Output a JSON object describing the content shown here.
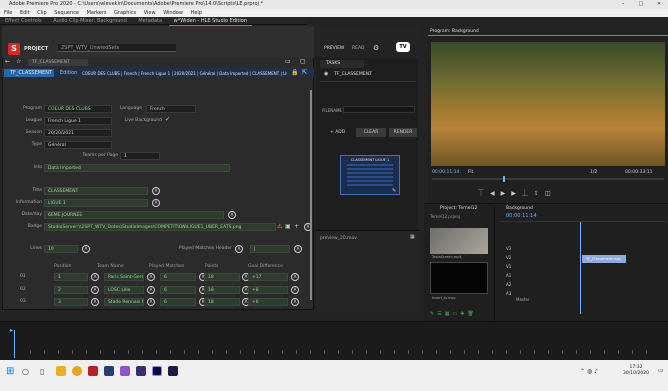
{
  "window": {
    "title": "Adobe Premiere Pro 2020 - C:\\Users\\wlevekin\\Documents\\Adobe\\Premiere Pro\\14.0\\Scripts\\LE.prproj *"
  },
  "menu": [
    "File",
    "Edit",
    "Clip",
    "Sequence",
    "Markers",
    "Graphics",
    "View",
    "Window",
    "Help"
  ],
  "panel_tabs": [
    "Effect Controls",
    "Audio Clip Mixer: Background",
    "Metadata",
    "w*Widen - HLE Studio Edition"
  ],
  "plugin": {
    "project_label": "PROJECT",
    "project_value": "2SPT_WTV_UnwiedSets",
    "tab_label": "TF_CLASSEMENT",
    "preview_label": "PREVIEW",
    "read_label": "READ",
    "brand_badge": "TV",
    "top_tab": "TF_CLASSEMENT",
    "edition_label": "Édition",
    "breadcrumb": "COEUR DES CLUBS | French | French Ligue 1 | 2020/2021 | Général | Data Imported | CLASSEMENT | LIGUE 1 |",
    "fields": {
      "program_label": "Program",
      "program_value": "COEUR DES CLUBS",
      "language_label": "Language",
      "language_value": "French",
      "league_label": "League",
      "league_value": "French Ligue 1",
      "livebg_label": "Live Background",
      "season_label": "Season",
      "season_value": "20/20/2021",
      "type_label": "Type",
      "type_value": "Général",
      "teams_label": "Teams per Page",
      "teams_value": "1",
      "info_label": "Info",
      "info_value": "Data Imported",
      "title_label": "Title",
      "title_value": "CLASSEMENT",
      "information_label": "Information",
      "information_value": "LIGUE 1",
      "dateday_label": "Date/day",
      "dateday_value": "6EME JOURNEE",
      "badge_label": "Badge",
      "badge_value": "StudioServer:\\\\2SPT_WTV_Dotes\\StudioImages\\COMPETITION\\LIGUE1_UBER_EATS.png",
      "lines_label": "Lines",
      "lines_value": "10",
      "played_label": "Played Matches Header",
      "played_value": "J"
    },
    "table": {
      "headers": [
        "Position",
        "Team Name",
        "Played Matches",
        "Points",
        "Goal Difference"
      ],
      "rows": [
        {
          "idx": "01",
          "position": "1",
          "team": "Paris Saint-Germain",
          "played": "6",
          "points": "18",
          "gd": "+17"
        },
        {
          "idx": "02",
          "position": "2",
          "team": "LOSC Lille",
          "played": "6",
          "points": "18",
          "gd": "+8"
        },
        {
          "idx": "03",
          "position": "3",
          "team": "Stade Rennais FC",
          "played": "6",
          "points": "18",
          "gd": "+6"
        }
      ]
    }
  },
  "middle": {
    "tasks_label": "TASKS",
    "item_label": "TF_CLASSEMENT",
    "filename_label": "FILENAME",
    "add_label": "ADD",
    "clear_label": "CLEAR",
    "render_label": "RENDER",
    "preview_title": "CLASSEMENT LIGUE 1",
    "clip_name": "preview_20.mov"
  },
  "program_monitor": {
    "title": "Program: Background",
    "timecode_left": "00:00:11:14",
    "fit": "Fit",
    "fraction": "1/2",
    "timecode_right": "00:00:33:11"
  },
  "project_panel": {
    "title": "Project: Ternel12",
    "sub": "Ternel12.prproj",
    "thumb1": "TeslaScreen.mp4",
    "thumb2": "Insert_tv.mov"
  },
  "timeline": {
    "title": "Background",
    "timecode": "00:00:11:14",
    "tracks": [
      "V3",
      "V2",
      "V1",
      "A1",
      "A2",
      "A3"
    ],
    "clip": "TF_Classement.mov",
    "master": "Master"
  },
  "clock": {
    "time": "17:32",
    "date": "30/10/2020"
  }
}
